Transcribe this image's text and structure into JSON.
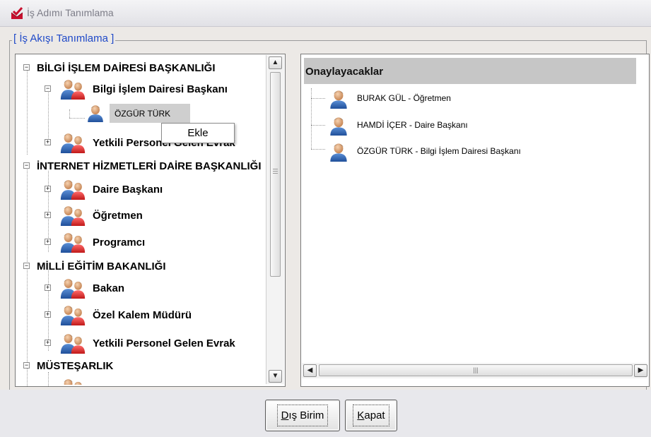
{
  "window": {
    "title": "İş Adımı Tanımlama"
  },
  "group": {
    "legend": "[ İş Akışı Tanımlama ]"
  },
  "tree": {
    "items": [
      {
        "label": "BİLGİ İŞLEM DAİRESİ BAŞKANLIĞI"
      },
      {
        "label": "Bilgi İşlem Dairesi Başkanı"
      },
      {
        "label": "ÖZGÜR TÜRK"
      },
      {
        "label": "Yetkili Personel Gelen Evrak"
      },
      {
        "label": "İNTERNET HİZMETLERİ DAİRE BAŞKANLIĞI"
      },
      {
        "label": "Daire Başkanı"
      },
      {
        "label": "Öğretmen"
      },
      {
        "label": "Programcı"
      },
      {
        "label": "MİLLİ EĞİTİM BAKANLIĞI"
      },
      {
        "label": "Bakan"
      },
      {
        "label": "Özel Kalem Müdürü"
      },
      {
        "label": "Yetkili Personel Gelen Evrak"
      },
      {
        "label": "MÜSTEŞARLIK"
      }
    ]
  },
  "context_menu": {
    "item": "Ekle"
  },
  "approvers": {
    "header": "Onaylayacaklar",
    "items": [
      {
        "label": "BURAK GÜL - Öğretmen"
      },
      {
        "label": "HAMDİ İÇER - Daire Başkanı"
      },
      {
        "label": "ÖZGÜR TÜRK - Bilgi İşlem Dairesi Başkanı"
      }
    ]
  },
  "buttons": {
    "dis_birim": {
      "mnemonic": "D",
      "rest": "ış Birim"
    },
    "kapat": {
      "mnemonic": "K",
      "rest": "apat"
    }
  },
  "icons": {
    "app": "envelope-check-icon",
    "group": "users-icon",
    "person": "user-icon"
  },
  "colors": {
    "legend": "#1f49c8",
    "header_bg": "#c6c6c6"
  }
}
